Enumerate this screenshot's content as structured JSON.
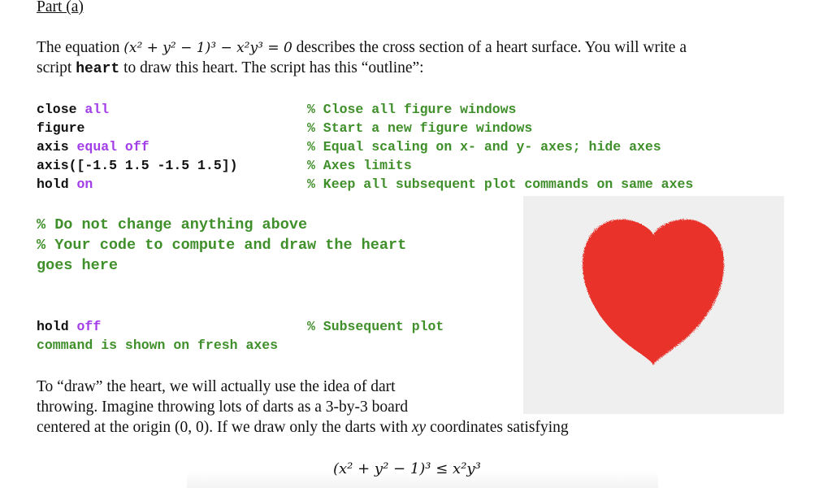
{
  "heading": "Part (a)",
  "intro": {
    "line1_pre": "The equation ",
    "line1_eq": "(x² + y² − 1)³ − x²y³ = 0",
    "line1_post": " describes the cross section of a heart surface. You will write a",
    "line2_pre": "script ",
    "line2_code": "heart",
    "line2_post": " to draw this heart. The script has this “outline”:"
  },
  "code_block": [
    {
      "cmd": "close",
      "arg": " all",
      "comment": "% Close all figure windows"
    },
    {
      "cmd": "figure",
      "arg": "",
      "comment": "% Start a new figure windows"
    },
    {
      "cmd": "axis",
      "arg": " equal off",
      "comment": "% Equal scaling on x- and y- axes; hide axes"
    },
    {
      "cmd": "axis([-1.5 1.5 -1.5 1.5])",
      "arg": "",
      "comment": "% Axes limits"
    },
    {
      "cmd": "hold",
      "arg": " on",
      "comment": "% Keep all subsequent plot commands on same axes"
    }
  ],
  "placeholder_comments": [
    "% Do not change anything above",
    "% Your code to compute and draw the heart",
    "goes here"
  ],
  "hold_off": {
    "cmd": "hold",
    "arg": " off",
    "comment": "% Subsequent plot",
    "comment_cont": "command is shown on fresh axes"
  },
  "paragraph": [
    "To “draw” the heart, we will actually use the idea of dart",
    "throwing. Imagine throwing lots of darts as a 3-by-3 board",
    "centered at the origin (0, 0). If we draw only the darts with "
  ],
  "paragraph_italic": "xy",
  "paragraph_end": " coordinates satisfying",
  "inequality": "(x² + y² − 1)³ ≤ x²y³",
  "colors": {
    "keyword_arg": "#a23ee8",
    "comment": "#3f8f2a",
    "heart": "#e8302a",
    "figure_bg": "#efefef"
  }
}
